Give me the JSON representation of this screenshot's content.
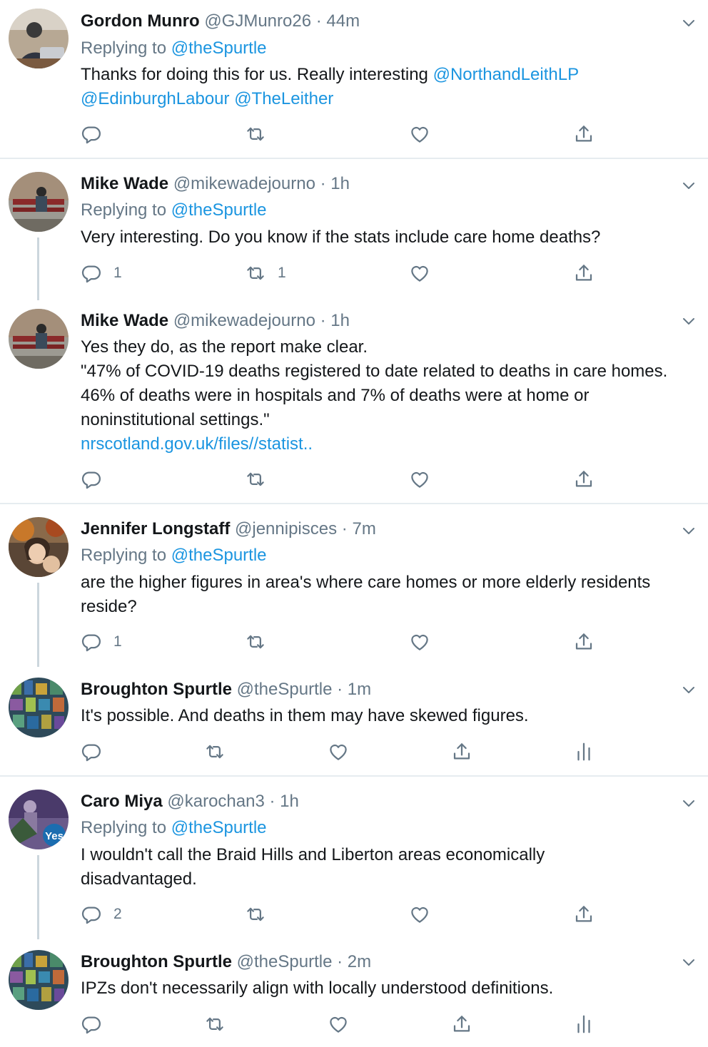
{
  "tweets": [
    {
      "name": "Gordon Munro",
      "handle": "@GJMunro26",
      "time": "44m",
      "replying_label": "Replying to",
      "replying_handle": "@theSpurtle",
      "text_plain": "Thanks for doing this for us. Really interesting ",
      "mention1": "@NorthandLeithLP",
      "mention2": "@EdinburghLabour",
      "mention3": "@TheLeither",
      "replies": "",
      "retweets": ""
    },
    {
      "name": "Mike Wade",
      "handle": "@mikewadejourno",
      "time": "1h",
      "replying_label": "Replying to",
      "replying_handle": "@theSpurtle",
      "text": "Very interesting.  Do you know if the stats include care home deaths?",
      "replies": "1",
      "retweets": "1"
    },
    {
      "name": "Mike Wade",
      "handle": "@mikewadejourno",
      "time": "1h",
      "line1": "Yes they do, as the report make clear.",
      "line2": "\"47% of COVID-19 deaths registered to date related to deaths in care homes. 46% of deaths were in hospitals and 7% of deaths were at home or noninstitutional settings.\"",
      "link": "nrscotland.gov.uk/files//statist..",
      "replies": "",
      "retweets": ""
    },
    {
      "name": "Jennifer Longstaff",
      "handle": "@jennipisces",
      "time": "7m",
      "replying_label": "Replying to",
      "replying_handle": "@theSpurtle",
      "text": "are the higher figures in area's where care homes or more elderly residents reside?",
      "replies": "1",
      "retweets": ""
    },
    {
      "name": "Broughton Spurtle",
      "handle": "@theSpurtle",
      "time": "1m",
      "text": "It's possible. And deaths in them may have skewed figures."
    },
    {
      "name": "Caro Miya",
      "handle": "@karochan3",
      "time": "1h",
      "replying_label": "Replying to",
      "replying_handle": "@theSpurtle",
      "text": "I wouldn't call the Braid Hills and Liberton areas economically disadvantaged.",
      "replies": "2",
      "retweets": "",
      "badge": "Yes"
    },
    {
      "name": "Broughton Spurtle",
      "handle": "@theSpurtle",
      "time": "2m",
      "text": "IPZs don't necessarily align with locally understood definitions."
    }
  ],
  "separator": "·",
  "icons": {
    "reply": "reply-icon",
    "retweet": "retweet-icon",
    "like": "heart-icon",
    "share": "share-icon",
    "analytics": "analytics-icon",
    "more": "chevron-down-icon"
  },
  "colors": {
    "link": "#1b95e0",
    "muted": "#657786",
    "text": "#14171a",
    "thread_line": "#ccd6dd",
    "divider": "#e6ecf0"
  }
}
